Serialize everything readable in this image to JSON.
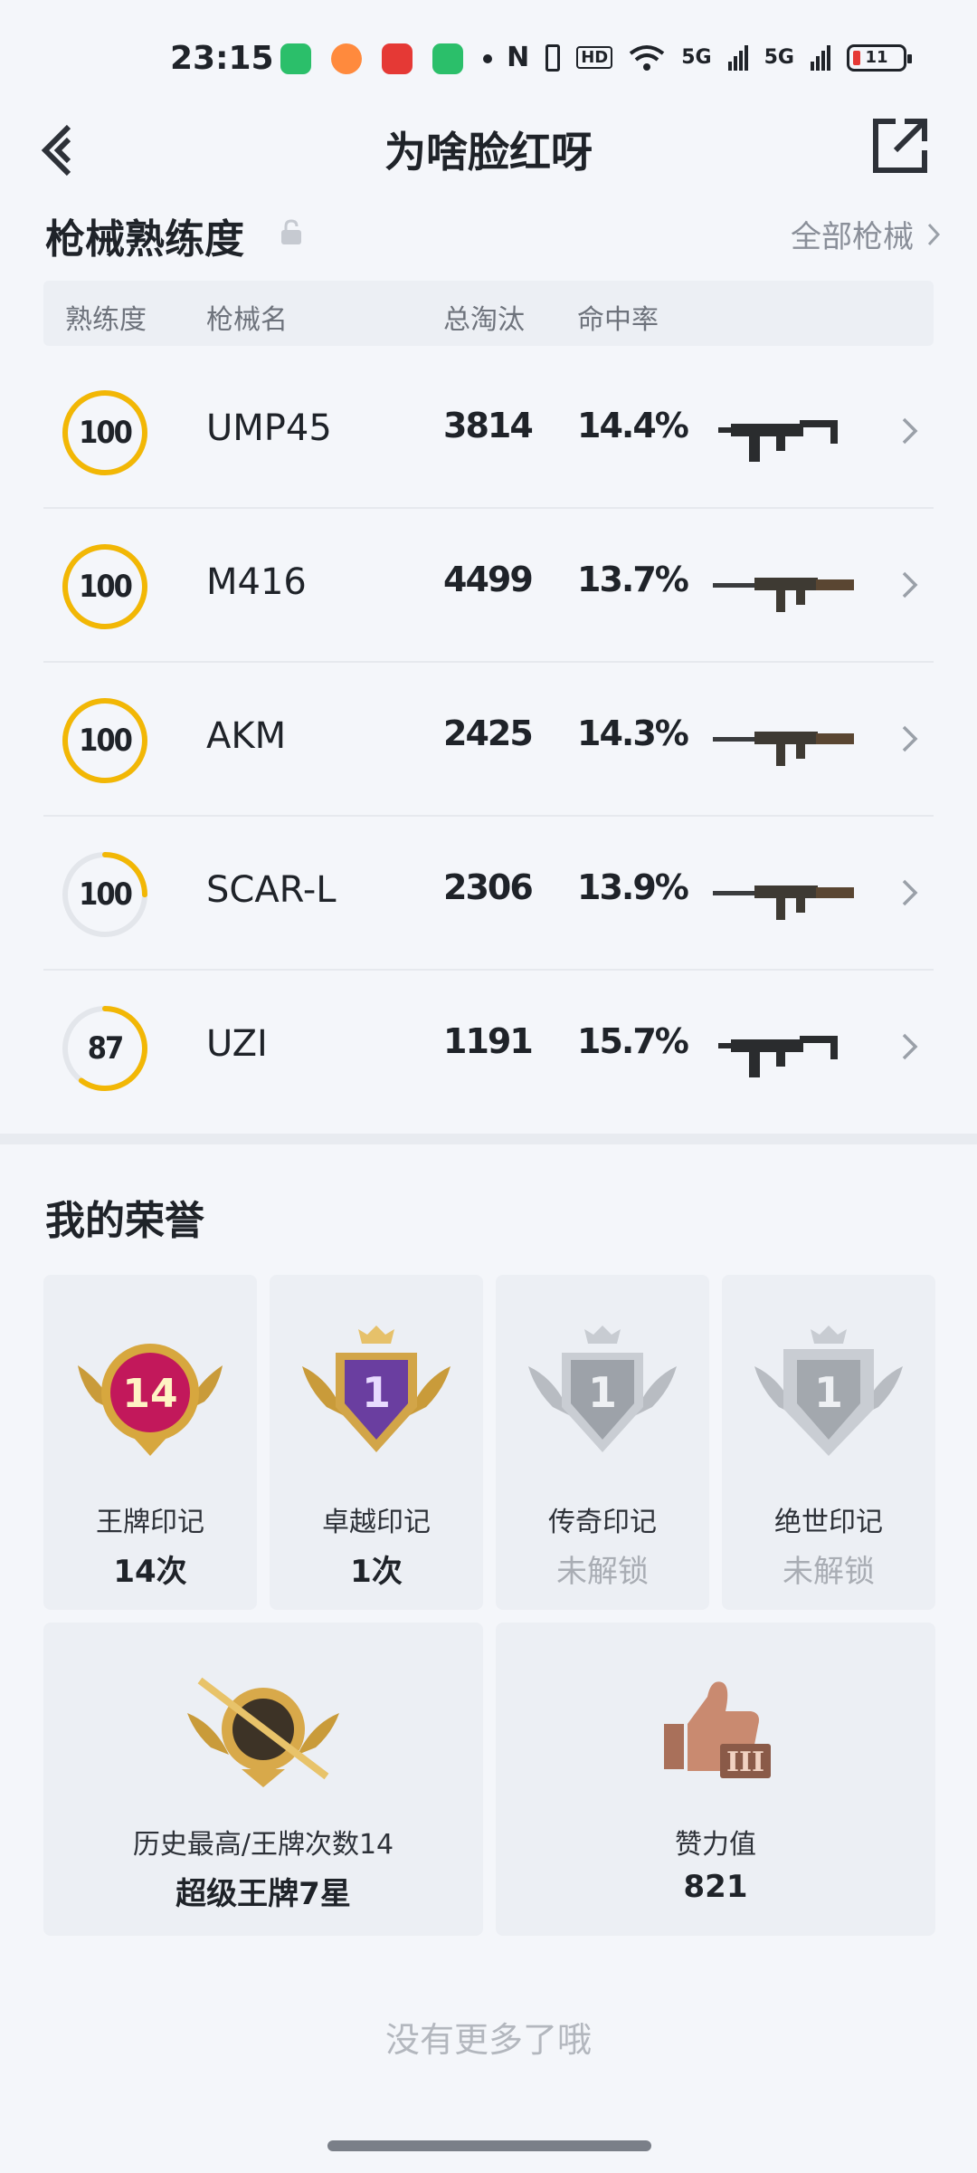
{
  "status_bar": {
    "time": "23:15",
    "battery": "11",
    "net1": "5G",
    "net2": "5G",
    "hd": "HD"
  },
  "header": {
    "title": "为啥脸红呀"
  },
  "weapons": {
    "title": "枪械熟练度",
    "all_link": "全部枪械",
    "columns": {
      "mastery": "熟练度",
      "name": "枪械名",
      "kills": "总淘汰",
      "hit_rate": "命中率"
    },
    "rows": [
      {
        "mastery": "100",
        "ring_progress": 1.0,
        "name": "UMP45",
        "kills": "3814",
        "hit_rate": "14.4%",
        "icon": "smg-icon"
      },
      {
        "mastery": "100",
        "ring_progress": 1.0,
        "name": "M416",
        "kills": "4499",
        "hit_rate": "13.7%",
        "icon": "rifle-icon"
      },
      {
        "mastery": "100",
        "ring_progress": 1.0,
        "name": "AKM",
        "kills": "2425",
        "hit_rate": "14.3%",
        "icon": "rifle-icon"
      },
      {
        "mastery": "100",
        "ring_progress": 0.25,
        "name": "SCAR-L",
        "kills": "2306",
        "hit_rate": "13.9%",
        "icon": "rifle-icon"
      },
      {
        "mastery": "87",
        "ring_progress": 0.6,
        "name": "UZI",
        "kills": "1191",
        "hit_rate": "15.7%",
        "icon": "smg-icon"
      }
    ]
  },
  "honors": {
    "title": "我的荣誉",
    "marks": [
      {
        "badge_number": "14",
        "label": "王牌印记",
        "value": "14次",
        "locked": false
      },
      {
        "badge_number": "1",
        "label": "卓越印记",
        "value": "1次",
        "locked": false
      },
      {
        "badge_number": "1",
        "label": "传奇印记",
        "value": "未解锁",
        "locked": true
      },
      {
        "badge_number": "1",
        "label": "绝世印记",
        "value": "未解锁",
        "locked": true
      }
    ],
    "history": {
      "label": "历史最高/王牌次数14",
      "value": "超级王牌7星"
    },
    "likes": {
      "label": "赞力值",
      "value": "821",
      "badge_tier": "III"
    }
  },
  "footer": {
    "no_more": "没有更多了哦"
  },
  "colors": {
    "ring_gold": "#f2b705",
    "ring_track": "#e3e6eb",
    "accent_text": "#1f2329",
    "muted": "#8a8f99"
  }
}
